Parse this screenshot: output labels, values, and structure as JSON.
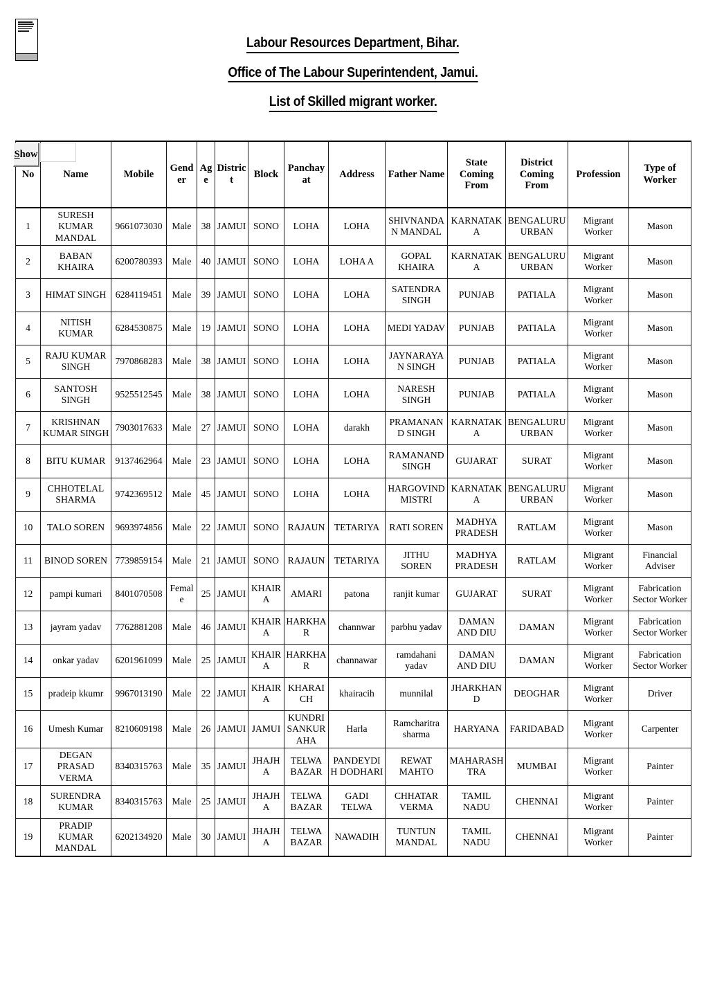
{
  "document": {
    "title_lines": [
      "Labour Resources Department, Bihar.",
      "Office of The Labour Superintendent, Jamui.",
      "List of Skilled migrant worker."
    ],
    "logo_alt": "broken-image-placeholder"
  },
  "controls": {
    "show_button_label": "Show",
    "show_button_accesskey_letter": "S",
    "show_input_value": "",
    "show_input_placeholder": ""
  },
  "table": {
    "columns": [
      "No",
      "Name",
      "Mobile",
      "Gender",
      "Age",
      "District",
      "Block",
      "Panchayat",
      "Address",
      "Father Name",
      "State Coming From",
      "District Coming From",
      "Profession",
      "Type of Worker"
    ],
    "rows": [
      {
        "no": "1",
        "name": "SURESH KUMAR MANDAL",
        "mobile": "9661073030",
        "gender": "Male",
        "age": "38",
        "district": "JAMUI",
        "block": "SONO",
        "panchayat": "LOHA",
        "address": "LOHA",
        "father_name": "SHIVNANDAN MANDAL",
        "state_from": "KARNATAKA",
        "district_from": "BENGALURU URBAN",
        "profession": "Migrant Worker",
        "type_of_worker": "Mason"
      },
      {
        "no": "2",
        "name": "BABAN KHAIRA",
        "mobile": "6200780393",
        "gender": "Male",
        "age": "40",
        "district": "JAMUI",
        "block": "SONO",
        "panchayat": "LOHA",
        "address": "LOHA A",
        "father_name": "GOPAL KHAIRA",
        "state_from": "KARNATAKA",
        "district_from": "BENGALURU URBAN",
        "profession": "Migrant Worker",
        "type_of_worker": "Mason"
      },
      {
        "no": "3",
        "name": "HIMAT SINGH",
        "mobile": "6284119451",
        "gender": "Male",
        "age": "39",
        "district": "JAMUI",
        "block": "SONO",
        "panchayat": "LOHA",
        "address": "LOHA",
        "father_name": "SATENDRA SINGH",
        "state_from": "PUNJAB",
        "district_from": "PATIALA",
        "profession": "Migrant Worker",
        "type_of_worker": "Mason"
      },
      {
        "no": "4",
        "name": "NITISH KUMAR",
        "mobile": "6284530875",
        "gender": "Male",
        "age": "19",
        "district": "JAMUI",
        "block": "SONO",
        "panchayat": "LOHA",
        "address": "LOHA",
        "father_name": "MEDI YADAV",
        "state_from": "PUNJAB",
        "district_from": "PATIALA",
        "profession": "Migrant Worker",
        "type_of_worker": "Mason"
      },
      {
        "no": "5",
        "name": "RAJU KUMAR SINGH",
        "mobile": "7970868283",
        "gender": "Male",
        "age": "38",
        "district": "JAMUI",
        "block": "SONO",
        "panchayat": "LOHA",
        "address": "LOHA",
        "father_name": "JAYNARAYAN SINGH",
        "state_from": "PUNJAB",
        "district_from": "PATIALA",
        "profession": "Migrant Worker",
        "type_of_worker": "Mason"
      },
      {
        "no": "6",
        "name": "SANTOSH SINGH",
        "mobile": "9525512545",
        "gender": "Male",
        "age": "38",
        "district": "JAMUI",
        "block": "SONO",
        "panchayat": "LOHA",
        "address": "LOHA",
        "father_name": "NARESH SINGH",
        "state_from": "PUNJAB",
        "district_from": "PATIALA",
        "profession": "Migrant Worker",
        "type_of_worker": "Mason"
      },
      {
        "no": "7",
        "name": "KRISHNAN KUMAR SINGH",
        "mobile": "7903017633",
        "gender": "Male",
        "age": "27",
        "district": "JAMUI",
        "block": "SONO",
        "panchayat": "LOHA",
        "address": "darakh",
        "father_name": "PRAMANAND SINGH",
        "state_from": "KARNATAKA",
        "district_from": "BENGALURU URBAN",
        "profession": "Migrant Worker",
        "type_of_worker": "Mason"
      },
      {
        "no": "8",
        "name": "BITU KUMAR",
        "mobile": "9137462964",
        "gender": "Male",
        "age": "23",
        "district": "JAMUI",
        "block": "SONO",
        "panchayat": "LOHA",
        "address": "LOHA",
        "father_name": "RAMANAND SINGH",
        "state_from": "GUJARAT",
        "district_from": "SURAT",
        "profession": "Migrant Worker",
        "type_of_worker": "Mason"
      },
      {
        "no": "9",
        "name": "CHHOTELAL SHARMA",
        "mobile": "9742369512",
        "gender": "Male",
        "age": "45",
        "district": "JAMUI",
        "block": "SONO",
        "panchayat": "LOHA",
        "address": "LOHA",
        "father_name": "HARGOVIND MISTRI",
        "state_from": "KARNATAKA",
        "district_from": "BENGALURU URBAN",
        "profession": "Migrant Worker",
        "type_of_worker": "Mason"
      },
      {
        "no": "10",
        "name": "TALO SOREN",
        "mobile": "9693974856",
        "gender": "Male",
        "age": "22",
        "district": "JAMUI",
        "block": "SONO",
        "panchayat": "RAJAUN",
        "address": "TETARIYA",
        "father_name": "RATI SOREN",
        "state_from": "MADHYA PRADESH",
        "district_from": "RATLAM",
        "profession": "Migrant Worker",
        "type_of_worker": "Mason"
      },
      {
        "no": "11",
        "name": "BINOD SOREN",
        "mobile": "7739859154",
        "gender": "Male",
        "age": "21",
        "district": "JAMUI",
        "block": "SONO",
        "panchayat": "RAJAUN",
        "address": "TETARIYA",
        "father_name": "JITHU SOREN",
        "state_from": "MADHYA PRADESH",
        "district_from": "RATLAM",
        "profession": "Migrant Worker",
        "type_of_worker": "Financial Adviser"
      },
      {
        "no": "12",
        "name": "pampi kumari",
        "mobile": "8401070508",
        "gender": "Female",
        "age": "25",
        "district": "JAMUI",
        "block": "KHAIRA",
        "panchayat": "AMARI",
        "address": "patona",
        "father_name": "ranjit kumar",
        "state_from": "GUJARAT",
        "district_from": "SURAT",
        "profession": "Migrant Worker",
        "type_of_worker": "Fabrication Sector Worker"
      },
      {
        "no": "13",
        "name": "jayram yadav",
        "mobile": "7762881208",
        "gender": "Male",
        "age": "46",
        "district": "JAMUI",
        "block": "KHAIRA",
        "panchayat": "HARKHAR",
        "address": "channwar",
        "father_name": "parbhu yadav",
        "state_from": "DAMAN AND DIU",
        "district_from": "DAMAN",
        "profession": "Migrant Worker",
        "type_of_worker": "Fabrication Sector Worker"
      },
      {
        "no": "14",
        "name": "onkar yadav",
        "mobile": "6201961099",
        "gender": "Male",
        "age": "25",
        "district": "JAMUI",
        "block": "KHAIRA",
        "panchayat": "HARKHAR",
        "address": "channawar",
        "father_name": "ramdahani yadav",
        "state_from": "DAMAN AND DIU",
        "district_from": "DAMAN",
        "profession": "Migrant Worker",
        "type_of_worker": "Fabrication Sector Worker"
      },
      {
        "no": "15",
        "name": "pradeip kkumr",
        "mobile": "9967013190",
        "gender": "Male",
        "age": "22",
        "district": "JAMUI",
        "block": "KHAIRA",
        "panchayat": "KHARAICH",
        "address": "khairacih",
        "father_name": "munnilal",
        "state_from": "JHARKHAND",
        "district_from": "DEOGHAR",
        "profession": "Migrant Worker",
        "type_of_worker": "Driver"
      },
      {
        "no": "16",
        "name": "Umesh Kumar",
        "mobile": "8210609198",
        "gender": "Male",
        "age": "26",
        "district": "JAMUI",
        "block": "JAMUI",
        "panchayat": "KUNDRI SANKURAHA",
        "address": "Harla",
        "father_name": "Ramcharitra sharma",
        "state_from": "HARYANA",
        "district_from": "FARIDABAD",
        "profession": "Migrant Worker",
        "type_of_worker": "Carpenter"
      },
      {
        "no": "17",
        "name": "DEGAN PRASAD VERMA",
        "mobile": "8340315763",
        "gender": "Male",
        "age": "35",
        "district": "JAMUI",
        "block": "JHAJHA",
        "panchayat": "TELWA BAZAR",
        "address": "PANDEYDIH DODHARI",
        "father_name": "REWAT MAHTO",
        "state_from": "MAHARASHTRA",
        "district_from": "MUMBAI",
        "profession": "Migrant Worker",
        "type_of_worker": "Painter"
      },
      {
        "no": "18",
        "name": "SURENDRA KUMAR",
        "mobile": "8340315763",
        "gender": "Male",
        "age": "25",
        "district": "JAMUI",
        "block": "JHAJHA",
        "panchayat": "TELWA BAZAR",
        "address": "GADI TELWA",
        "father_name": "CHHATAR VERMA",
        "state_from": "TAMIL NADU",
        "district_from": "CHENNAI",
        "profession": "Migrant Worker",
        "type_of_worker": "Painter"
      },
      {
        "no": "19",
        "name": "PRADIP KUMAR MANDAL",
        "mobile": "6202134920",
        "gender": "Male",
        "age": "30",
        "district": "JAMUI",
        "block": "JHAJHA",
        "panchayat": "TELWA BAZAR",
        "address": "NAWADIH",
        "father_name": "TUNTUN MANDAL",
        "state_from": "TAMIL NADU",
        "district_from": "CHENNAI",
        "profession": "Migrant Worker",
        "type_of_worker": "Painter"
      }
    ]
  }
}
